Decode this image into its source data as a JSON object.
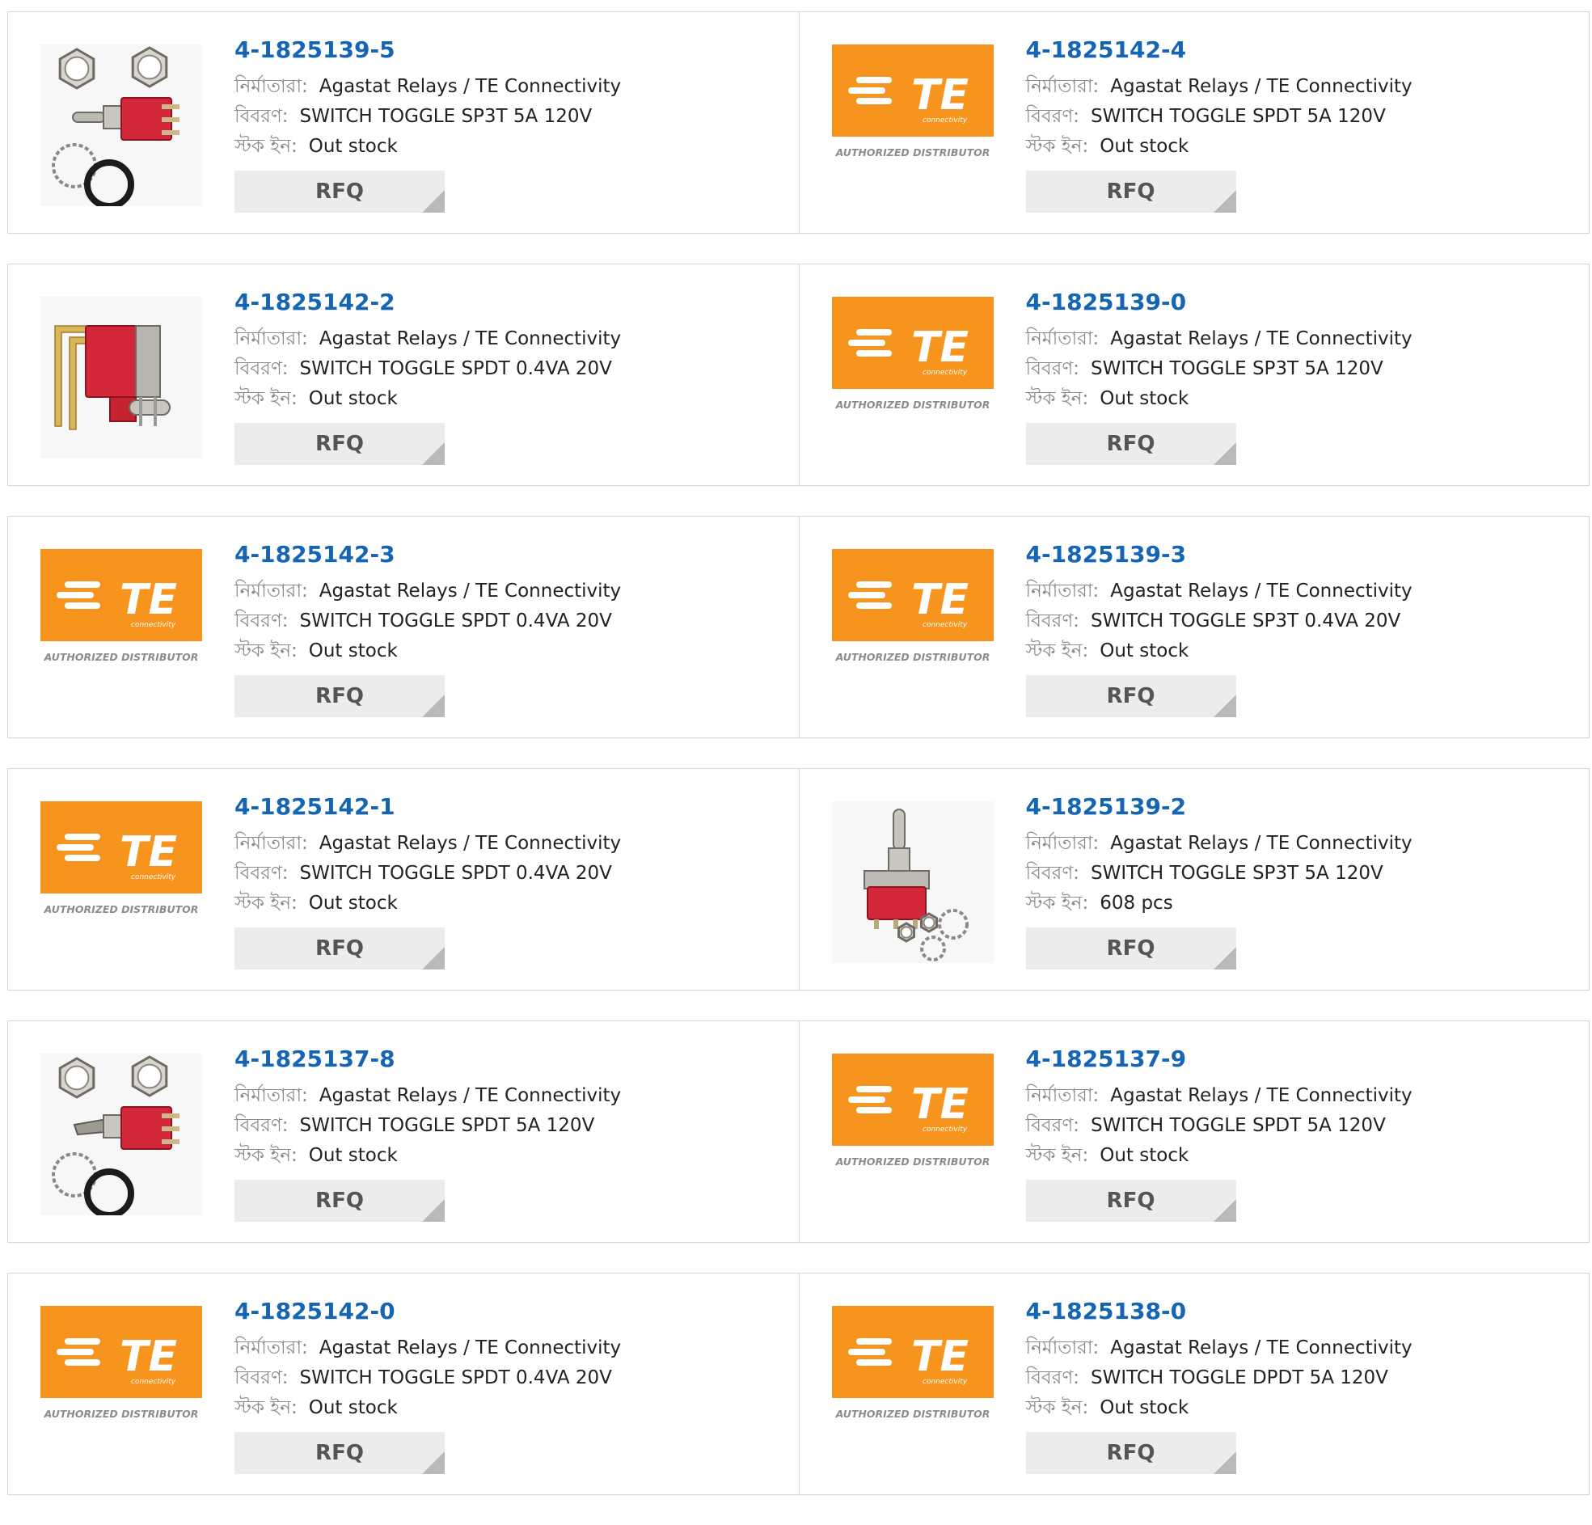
{
  "labels": {
    "manufacturer": "নির্মাতারা:",
    "description": "বিবরণ:",
    "stock": "স্টক ইন:",
    "rfq": "RFQ"
  },
  "logo": {
    "text": "TE",
    "subtext": "connectivity",
    "tagline": "AUTHORIZED DISTRIBUTOR",
    "color": "#f7941d"
  },
  "products": [
    {
      "part": "4-1825139-5",
      "manufacturer": "Agastat Relays / TE Connectivity",
      "description": "SWITCH TOGGLE SP3T 5A 120V",
      "stock": "Out stock",
      "image": "toggle-switch-with-nuts-photo"
    },
    {
      "part": "4-1825142-4",
      "manufacturer": "Agastat Relays / TE Connectivity",
      "description": "SWITCH TOGGLE SPDT 5A 120V",
      "stock": "Out stock",
      "image": "te-logo"
    },
    {
      "part": "4-1825142-2",
      "manufacturer": "Agastat Relays / TE Connectivity",
      "description": "SWITCH TOGGLE SPDT 0.4VA 20V",
      "stock": "Out stock",
      "image": "right-angle-toggle-photo"
    },
    {
      "part": "4-1825139-0",
      "manufacturer": "Agastat Relays / TE Connectivity",
      "description": "SWITCH TOGGLE SP3T 5A 120V",
      "stock": "Out stock",
      "image": "te-logo"
    },
    {
      "part": "4-1825142-3",
      "manufacturer": "Agastat Relays / TE Connectivity",
      "description": "SWITCH TOGGLE SPDT 0.4VA 20V",
      "stock": "Out stock",
      "image": "te-logo"
    },
    {
      "part": "4-1825139-3",
      "manufacturer": "Agastat Relays / TE Connectivity",
      "description": "SWITCH TOGGLE SP3T 0.4VA 20V",
      "stock": "Out stock",
      "image": "te-logo"
    },
    {
      "part": "4-1825142-1",
      "manufacturer": "Agastat Relays / TE Connectivity",
      "description": "SWITCH TOGGLE SPDT 0.4VA 20V",
      "stock": "Out stock",
      "image": "te-logo"
    },
    {
      "part": "4-1825139-2",
      "manufacturer": "Agastat Relays / TE Connectivity",
      "description": "SWITCH TOGGLE SP3T 5A 120V",
      "stock": "608 pcs",
      "image": "vertical-toggle-with-washers-photo"
    },
    {
      "part": "4-1825137-8",
      "manufacturer": "Agastat Relays / TE Connectivity",
      "description": "SWITCH TOGGLE SPDT 5A 120V",
      "stock": "Out stock",
      "image": "lever-toggle-with-nuts-photo"
    },
    {
      "part": "4-1825137-9",
      "manufacturer": "Agastat Relays / TE Connectivity",
      "description": "SWITCH TOGGLE SPDT 5A 120V",
      "stock": "Out stock",
      "image": "te-logo"
    },
    {
      "part": "4-1825142-0",
      "manufacturer": "Agastat Relays / TE Connectivity",
      "description": "SWITCH TOGGLE SPDT 0.4VA 20V",
      "stock": "Out stock",
      "image": "te-logo"
    },
    {
      "part": "4-1825138-0",
      "manufacturer": "Agastat Relays / TE Connectivity",
      "description": "SWITCH TOGGLE DPDT 5A 120V",
      "stock": "Out stock",
      "image": "te-logo"
    }
  ]
}
